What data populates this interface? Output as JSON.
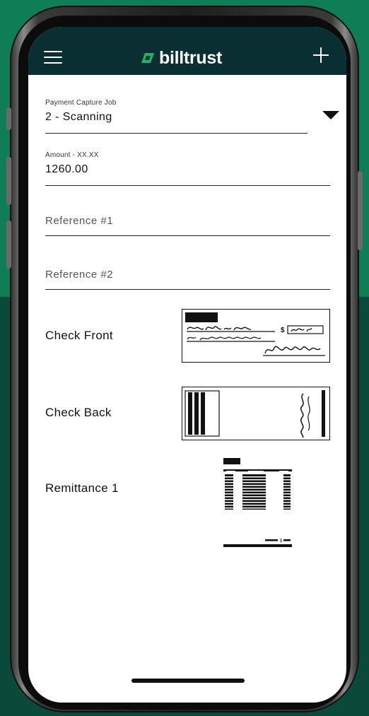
{
  "app": {
    "brand_name": "billtrust",
    "menu_icon": "hamburger-menu-icon",
    "add_icon": "plus-icon"
  },
  "form": {
    "job": {
      "label": "Payment Capture Job",
      "value": "2 - Scanning"
    },
    "amount": {
      "label": "Amount - XX.XX",
      "value": "1260.00"
    },
    "reference1": {
      "placeholder": "Reference #1"
    },
    "reference2": {
      "placeholder": "Reference #2"
    }
  },
  "captures": [
    {
      "label": "Check Front",
      "thumbnail": "check-front-image"
    },
    {
      "label": "Check Back",
      "thumbnail": "check-back-image"
    },
    {
      "label": "Remittance 1",
      "thumbnail": "remittance-document-image"
    }
  ],
  "colors": {
    "header_bg": "#0a2f33",
    "brand_green": "#1fb36a",
    "background_top": "#0f7d55",
    "background_bottom": "#0b4a3b"
  }
}
